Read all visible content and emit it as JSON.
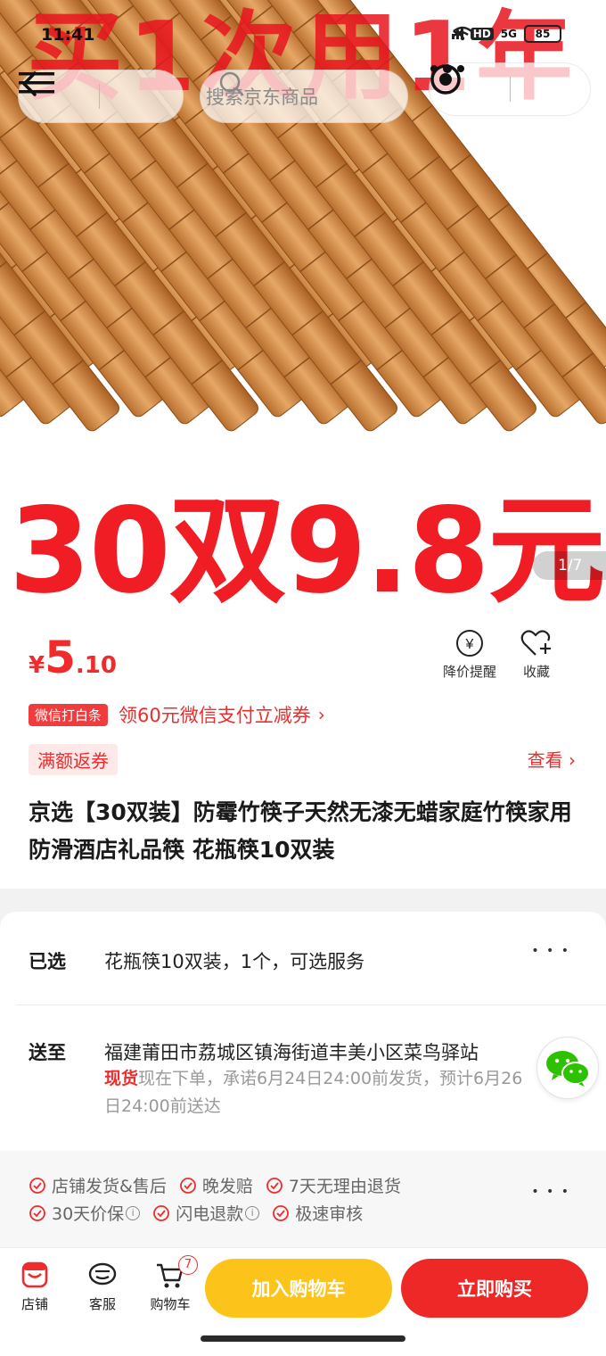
{
  "status_bar": {
    "time": "11:41",
    "hd": "HD",
    "network": "5G",
    "battery": "85"
  },
  "nav": {
    "search_placeholder": "搜索京东商品"
  },
  "hero": {
    "banner_top": "买1次用1年",
    "banner_price": "30双9.8元",
    "pager": "1/7"
  },
  "price": {
    "currency": "¥",
    "integer": "5",
    "decimal": ".10"
  },
  "actions": {
    "remind": "降价提醒",
    "favorite": "收藏"
  },
  "coupon": {
    "tag": "微信打白条",
    "text": "领60元微信支付立减券",
    "chevron": "›"
  },
  "promo": {
    "tag": "满额返券",
    "link": "查看",
    "chevron": "›"
  },
  "product": {
    "title": "京选【30双装】防霉竹筷子天然无漆无蜡家庭竹筷家用防滑酒店礼品筷 花瓶筷10双装"
  },
  "spec": {
    "selected_label": "已选",
    "selected_value": "花瓶筷10双装，1个，可选服务",
    "ship_label": "送至",
    "address": "福建莆田市荔城区镇海街道丰美小区菜鸟驿站",
    "stock": "现货",
    "delivery": "现在下单，承诺6月24日24:00前发货，预计6月26日24:00前送达"
  },
  "guarantee": {
    "line1": [
      "店铺发货&售后",
      "晚发赔",
      "7天无理由退货"
    ],
    "line2": [
      "30天价保",
      "闪电退款",
      "极速审核"
    ]
  },
  "bottom": {
    "shop": "店铺",
    "service": "客服",
    "cart": "购物车",
    "cart_count": "7",
    "add_to_cart": "加入购物车",
    "buy_now": "立即购买"
  },
  "colors": {
    "accent_red": "#f02b2b",
    "cart_yellow": "#fcc41a",
    "buy_red": "#ee2727"
  }
}
